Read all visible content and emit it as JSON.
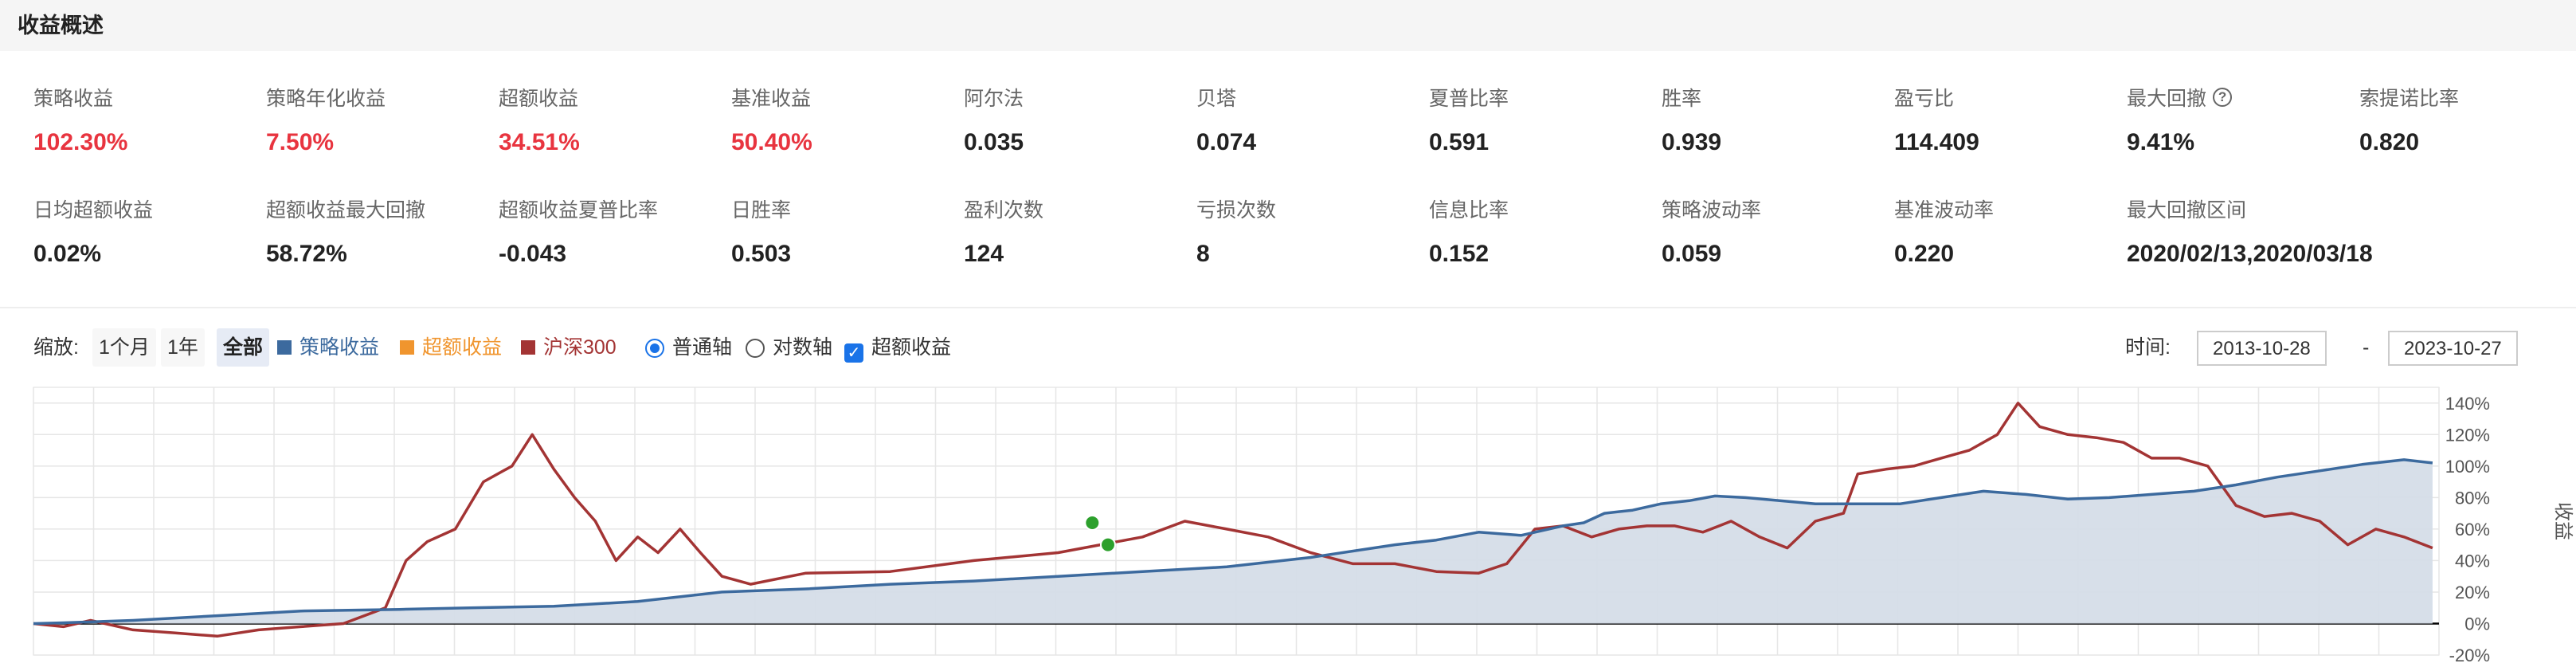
{
  "header": {
    "title": "收益概述"
  },
  "metrics_row1": [
    {
      "label": "策略收益",
      "value": "102.30%",
      "color": "red"
    },
    {
      "label": "策略年化收益",
      "value": "7.50%",
      "color": "red"
    },
    {
      "label": "超额收益",
      "value": "34.51%",
      "color": "red"
    },
    {
      "label": "基准收益",
      "value": "50.40%",
      "color": "red"
    },
    {
      "label": "阿尔法",
      "value": "0.035",
      "color": "black"
    },
    {
      "label": "贝塔",
      "value": "0.074",
      "color": "black"
    },
    {
      "label": "夏普比率",
      "value": "0.591",
      "color": "black"
    },
    {
      "label": "胜率",
      "value": "0.939",
      "color": "black"
    },
    {
      "label": "盈亏比",
      "value": "114.409",
      "color": "black"
    },
    {
      "label": "最大回撤",
      "value": "9.41%",
      "color": "black",
      "help_icon": "question-circle-icon",
      "help_glyph": "?"
    },
    {
      "label": "索提诺比率",
      "value": "0.820",
      "color": "black"
    }
  ],
  "metrics_row2": [
    {
      "label": "日均超额收益",
      "value": "0.02%"
    },
    {
      "label": "超额收益最大回撤",
      "value": "58.72%"
    },
    {
      "label": "超额收益夏普比率",
      "value": "-0.043"
    },
    {
      "label": "日胜率",
      "value": "0.503"
    },
    {
      "label": "盈利次数",
      "value": "124"
    },
    {
      "label": "亏损次数",
      "value": "8"
    },
    {
      "label": "信息比率",
      "value": "0.152"
    },
    {
      "label": "策略波动率",
      "value": "0.059"
    },
    {
      "label": "基准波动率",
      "value": "0.220"
    },
    {
      "label": "最大回撤区间",
      "value": "2020/02/13,2020/03/18"
    }
  ],
  "toolbar": {
    "zoom_label": "缩放:",
    "zoom_options": [
      "1个月",
      "1年",
      "全部"
    ],
    "zoom_selected": "全部",
    "legend": [
      {
        "name": "策略收益",
        "color": "#3c6a9e"
      },
      {
        "name": "超额收益",
        "color": "#f0952e"
      },
      {
        "name": "沪深300",
        "color": "#a33434"
      }
    ],
    "axis_options": [
      "普通轴",
      "对数轴"
    ],
    "axis_selected": "普通轴",
    "excess_checkbox_label": "超额收益",
    "excess_checked": true,
    "time_label": "时间:",
    "date_from": "2013-10-28",
    "date_separator": "-",
    "date_to": "2023-10-27"
  },
  "chart_data": {
    "type": "line",
    "ylabel": "收益",
    "ylim": [
      -20,
      150
    ],
    "y_ticks": [
      -20,
      0,
      20,
      40,
      60,
      80,
      100,
      120,
      140
    ],
    "y_tick_labels": [
      "-20%",
      "0%",
      "20%",
      "40%",
      "60%",
      "80%",
      "100%",
      "120%",
      "140%"
    ],
    "grid": true,
    "x_range": [
      "2013-10-28",
      "2023-10-27"
    ],
    "series": [
      {
        "name": "策略收益",
        "color": "#3c6a9e",
        "fill": "#d5dde8",
        "points": [
          [
            "2013-10-28",
            0
          ],
          [
            "2014-01-01",
            0.5
          ],
          [
            "2014-06-01",
            2
          ],
          [
            "2014-12-01",
            5
          ],
          [
            "2015-06-01",
            8
          ],
          [
            "2016-01-01",
            9
          ],
          [
            "2016-06-01",
            10
          ],
          [
            "2016-12-01",
            11
          ],
          [
            "2017-06-01",
            14
          ],
          [
            "2017-12-01",
            20
          ],
          [
            "2018-06-01",
            22
          ],
          [
            "2018-12-01",
            25
          ],
          [
            "2019-06-01",
            27
          ],
          [
            "2019-12-01",
            30
          ],
          [
            "2020-06-01",
            33
          ],
          [
            "2020-12-01",
            36
          ],
          [
            "2021-06-01",
            42
          ],
          [
            "2021-12-01",
            50
          ],
          [
            "2022-03-01",
            53
          ],
          [
            "2022-06-01",
            58
          ],
          [
            "2022-09-01",
            56
          ],
          [
            "2022-12-01",
            62
          ],
          [
            "2023-01-15",
            64
          ],
          [
            "2023-03-01",
            70
          ],
          [
            "2023-05-01",
            72
          ],
          [
            "2023-07-01",
            76
          ],
          [
            "2023-09-01",
            78
          ],
          [
            "2023-10-27",
            81
          ],
          [
            "2024-01-01",
            80
          ],
          [
            "2024-06-01",
            76
          ],
          [
            "2024-12-01",
            76
          ],
          [
            "2025-03-01",
            80
          ],
          [
            "2025-06-01",
            84
          ],
          [
            "2025-09-01",
            82
          ],
          [
            "2025-12-01",
            79
          ],
          [
            "2026-03-01",
            80
          ],
          [
            "2026-06-01",
            82
          ],
          [
            "2026-09-01",
            84
          ],
          [
            "2026-12-01",
            88
          ],
          [
            "2027-03-01",
            93
          ],
          [
            "2027-06-01",
            97
          ],
          [
            "2027-09-01",
            101
          ],
          [
            "2027-12-01",
            104
          ],
          [
            "2028-02-01",
            102
          ]
        ]
      },
      {
        "name": "沪深300",
        "color": "#a33434",
        "points": [
          [
            "2013-10-28",
            0
          ],
          [
            "2014-01-01",
            -2
          ],
          [
            "2014-03-01",
            2
          ],
          [
            "2014-06-01",
            -4
          ],
          [
            "2014-09-01",
            -6
          ],
          [
            "2014-12-01",
            -8
          ],
          [
            "2015-03-01",
            -4
          ],
          [
            "2015-06-01",
            -2
          ],
          [
            "2015-09-01",
            0
          ],
          [
            "2015-12-01",
            10
          ],
          [
            "2016-01-15",
            40
          ],
          [
            "2016-03-01",
            52
          ],
          [
            "2016-05-01",
            60
          ],
          [
            "2016-07-01",
            90
          ],
          [
            "2016-09-01",
            100
          ],
          [
            "2016-10-15",
            120
          ],
          [
            "2016-12-01",
            98
          ],
          [
            "2017-01-15",
            80
          ],
          [
            "2017-03-01",
            65
          ],
          [
            "2017-04-15",
            40
          ],
          [
            "2017-06-01",
            55
          ],
          [
            "2017-07-15",
            45
          ],
          [
            "2017-09-01",
            60
          ],
          [
            "2017-10-15",
            45
          ],
          [
            "2017-12-01",
            30
          ],
          [
            "2018-02-01",
            25
          ],
          [
            "2018-06-01",
            32
          ],
          [
            "2018-12-01",
            33
          ],
          [
            "2019-06-01",
            40
          ],
          [
            "2019-12-01",
            45
          ],
          [
            "2020-06-01",
            55
          ],
          [
            "2020-09-01",
            65
          ],
          [
            "2020-12-01",
            60
          ],
          [
            "2021-03-01",
            55
          ],
          [
            "2021-06-01",
            45
          ],
          [
            "2021-09-01",
            38
          ],
          [
            "2021-12-01",
            38
          ],
          [
            "2022-03-01",
            33
          ],
          [
            "2022-06-01",
            32
          ],
          [
            "2022-08-01",
            38
          ],
          [
            "2022-10-01",
            60
          ],
          [
            "2022-12-01",
            62
          ],
          [
            "2023-02-01",
            55
          ],
          [
            "2023-04-01",
            60
          ],
          [
            "2023-06-01",
            62
          ],
          [
            "2023-08-01",
            62
          ],
          [
            "2023-10-01",
            58
          ],
          [
            "2023-12-01",
            65
          ],
          [
            "2024-02-01",
            55
          ],
          [
            "2024-04-01",
            48
          ],
          [
            "2024-06-01",
            65
          ],
          [
            "2024-08-01",
            70
          ],
          [
            "2024-09-01",
            95
          ],
          [
            "2024-11-01",
            98
          ],
          [
            "2025-01-01",
            100
          ],
          [
            "2025-03-01",
            105
          ],
          [
            "2025-05-01",
            110
          ],
          [
            "2025-07-01",
            120
          ],
          [
            "2025-08-15",
            140
          ],
          [
            "2025-10-01",
            125
          ],
          [
            "2025-12-01",
            120
          ],
          [
            "2026-02-01",
            118
          ],
          [
            "2026-04-01",
            115
          ],
          [
            "2026-06-01",
            105
          ],
          [
            "2026-08-01",
            105
          ],
          [
            "2026-10-01",
            100
          ],
          [
            "2026-12-01",
            75
          ],
          [
            "2027-02-01",
            68
          ],
          [
            "2027-04-01",
            70
          ],
          [
            "2027-06-01",
            65
          ],
          [
            "2027-08-01",
            50
          ],
          [
            "2027-10-01",
            60
          ],
          [
            "2027-12-01",
            55
          ],
          [
            "2028-02-01",
            48
          ]
        ]
      }
    ],
    "markers": [
      {
        "date": "2020-02-13",
        "value": 64,
        "color": "#2ca02c"
      },
      {
        "date": "2020-03-18",
        "value": 50,
        "color": "#2ca02c"
      }
    ]
  }
}
